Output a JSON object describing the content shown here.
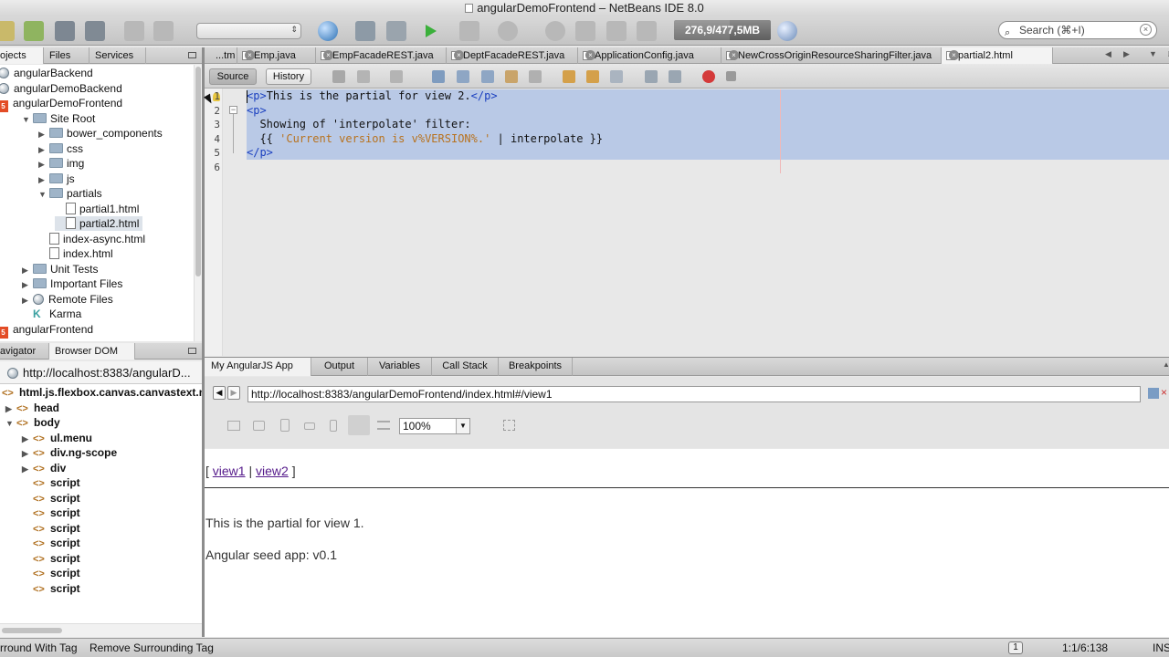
{
  "window": {
    "title": "angularDemoFrontend – NetBeans IDE 8.0"
  },
  "toolbar": {
    "config_value": "",
    "memory": "276,9/477,5MB",
    "memory_used_mb": 276.9,
    "memory_total_mb": 477.5,
    "search_placeholder": "Search (⌘+I)",
    "icons": [
      "new-file-icon",
      "new-project-icon",
      "open-project-icon",
      "save-all-icon",
      "undo-icon",
      "redo-icon",
      "globe-icon",
      "build-icon",
      "clean-build-icon",
      "run-icon",
      "debug-icon",
      "profile-icon",
      "pause-icon",
      "step-over-icon",
      "step-into-icon",
      "step-out-icon",
      "gc-icon"
    ]
  },
  "projects_panel": {
    "tabs": [
      {
        "label": "ojects"
      },
      {
        "label": "Files"
      },
      {
        "label": "Services"
      }
    ],
    "tree": [
      {
        "label": "angularBackend",
        "type": "globe",
        "indent": 0
      },
      {
        "label": "angularDemoBackend",
        "type": "globe",
        "indent": 0
      },
      {
        "label": "angularDemoFrontend",
        "type": "html5",
        "indent": 0
      },
      {
        "label": "Site Root",
        "type": "folder",
        "indent": 1,
        "arrow": "▼"
      },
      {
        "label": "bower_components",
        "type": "folder",
        "indent": 2,
        "arrow": "▶"
      },
      {
        "label": "css",
        "type": "folder",
        "indent": 2,
        "arrow": "▶"
      },
      {
        "label": "img",
        "type": "folder",
        "indent": 2,
        "arrow": "▶"
      },
      {
        "label": "js",
        "type": "folder",
        "indent": 2,
        "arrow": "▶"
      },
      {
        "label": "partials",
        "type": "folder",
        "indent": 2,
        "arrow": "▼"
      },
      {
        "label": "partial1.html",
        "type": "html",
        "indent": 3
      },
      {
        "label": "partial2.html",
        "type": "html",
        "indent": 3,
        "selected": true
      },
      {
        "label": "index-async.html",
        "type": "html",
        "indent": 2
      },
      {
        "label": "index.html",
        "type": "html",
        "indent": 2
      },
      {
        "label": "Unit Tests",
        "type": "folder",
        "indent": 1,
        "arrow": "▶"
      },
      {
        "label": "Important Files",
        "type": "folder",
        "indent": 1,
        "arrow": "▶"
      },
      {
        "label": "Remote Files",
        "type": "globe",
        "indent": 1,
        "arrow": "▶"
      },
      {
        "label": "Karma",
        "type": "karma",
        "indent": 1
      },
      {
        "label": "angularFrontend",
        "type": "html5",
        "indent": 0
      }
    ]
  },
  "dom_panel": {
    "tabs": [
      {
        "label": "avigator"
      },
      {
        "label": "Browser DOM"
      }
    ],
    "url": "http://localhost:8383/angularD...",
    "tree": [
      {
        "label": "html.js.flexbox.canvas.canvastext.no",
        "indent": 0,
        "bold": true
      },
      {
        "label": "head",
        "indent": 1,
        "arrow": "▶"
      },
      {
        "label": "body",
        "indent": 1,
        "arrow": "▼"
      },
      {
        "label": "ul.menu",
        "indent": 2,
        "arrow": "▶"
      },
      {
        "label": "div.ng-scope",
        "indent": 2,
        "arrow": "▶"
      },
      {
        "label": "div",
        "indent": 2,
        "arrow": "▶"
      },
      {
        "label": "script",
        "indent": 2
      },
      {
        "label": "script",
        "indent": 2
      },
      {
        "label": "script",
        "indent": 2
      },
      {
        "label": "script",
        "indent": 2
      },
      {
        "label": "script",
        "indent": 2
      },
      {
        "label": "script",
        "indent": 2
      },
      {
        "label": "script",
        "indent": 2
      },
      {
        "label": "script",
        "indent": 2
      }
    ]
  },
  "editor": {
    "tabs": [
      {
        "label": "...tm"
      },
      {
        "label": "Emp.java"
      },
      {
        "label": "EmpFacadeREST.java"
      },
      {
        "label": "DeptFacadeREST.java"
      },
      {
        "label": "ApplicationConfig.java"
      },
      {
        "label": "NewCrossOriginResourceSharingFilter.java"
      },
      {
        "label": "partial2.html",
        "active": true
      }
    ],
    "source_label": "Source",
    "history_label": "History",
    "lines": [
      {
        "n": "1",
        "parts": [
          [
            "t",
            "<p>"
          ],
          [
            "x",
            "This is the partial for view 2."
          ],
          [
            "t",
            "</p>"
          ]
        ]
      },
      {
        "n": "2",
        "parts": [
          [
            "t",
            "<p>"
          ]
        ]
      },
      {
        "n": "3",
        "parts": [
          [
            "x",
            "  Showing of 'interpolate' filter:"
          ]
        ]
      },
      {
        "n": "4",
        "parts": [
          [
            "x",
            "  {{ "
          ],
          [
            "s",
            "'Current version is v%VERSION%.'"
          ],
          [
            "x",
            " | interpolate }}"
          ]
        ]
      },
      {
        "n": "5",
        "parts": [
          [
            "t",
            "</p>"
          ]
        ]
      },
      {
        "n": "6",
        "parts": []
      }
    ]
  },
  "bottom": {
    "tabs": [
      {
        "label": "My AngularJS App",
        "active": true
      },
      {
        "label": "Output"
      },
      {
        "label": "Variables"
      },
      {
        "label": "Call Stack"
      },
      {
        "label": "Breakpoints"
      }
    ],
    "url": "http://localhost:8383/angularDemoFrontend/index.html#/view1",
    "zoom": "100%",
    "page": {
      "link1": "view1",
      "link2": "view2",
      "bracket_open": "[",
      "separator": "|",
      "bracket_close": "]",
      "text1": "This is the partial for view 1.",
      "text2": "Angular seed app: v0.1"
    }
  },
  "status": {
    "left1": "rround With Tag",
    "left2": "Remove Surrounding Tag",
    "notifications": "1",
    "position": "1:1/6:138",
    "mode": "INS"
  }
}
